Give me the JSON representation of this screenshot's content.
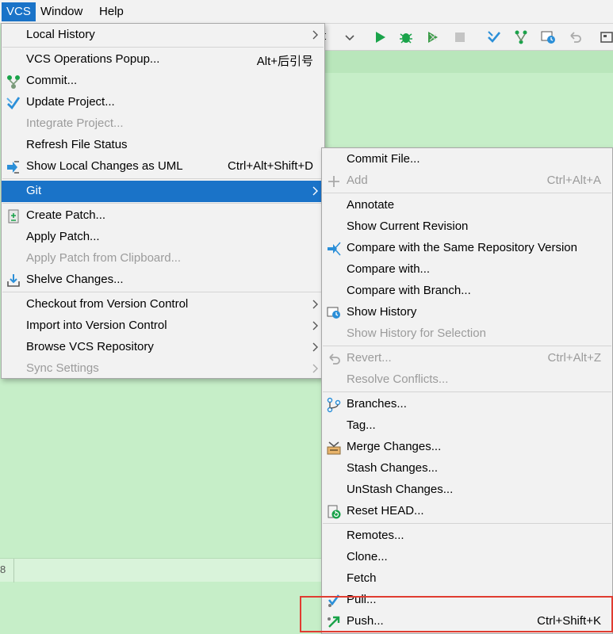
{
  "menubar": {
    "items": [
      {
        "label": "VCS",
        "active": true
      },
      {
        "label": "Window",
        "active": false
      },
      {
        "label": "Help",
        "active": false
      }
    ]
  },
  "editor": {
    "toolbar_fragment": "t",
    "line_number": "8"
  },
  "vcs_menu": {
    "items": [
      {
        "label": "Local History",
        "submenu": true
      },
      {
        "label": "VCS Operations Popup...",
        "shortcut": "Alt+后引号"
      },
      {
        "label": "Commit...",
        "icon": "commit-icon"
      },
      {
        "label": "Update Project...",
        "icon": "update-project-icon"
      },
      {
        "label": "Integrate Project...",
        "disabled": true
      },
      {
        "label": "Refresh File Status"
      },
      {
        "label": "Show Local Changes as UML",
        "shortcut": "Ctrl+Alt+Shift+D",
        "icon": "uml-icon"
      },
      {
        "label": "Git",
        "submenu": true,
        "selected": true
      },
      {
        "label": "Create Patch...",
        "icon": "patch-icon"
      },
      {
        "label": "Apply Patch..."
      },
      {
        "label": "Apply Patch from Clipboard...",
        "disabled": true
      },
      {
        "label": "Shelve Changes...",
        "icon": "shelve-icon"
      },
      {
        "label": "Checkout from Version Control",
        "submenu": true
      },
      {
        "label": "Import into Version Control",
        "submenu": true
      },
      {
        "label": "Browse VCS Repository",
        "submenu": true
      },
      {
        "label": "Sync Settings",
        "submenu": true,
        "disabled": true
      }
    ]
  },
  "git_menu": {
    "items": [
      {
        "label": "Commit File..."
      },
      {
        "label": "Add",
        "shortcut": "Ctrl+Alt+A",
        "disabled": true,
        "icon": "plus-icon"
      },
      {
        "label": "Annotate"
      },
      {
        "label": "Show Current Revision"
      },
      {
        "label": "Compare with the Same Repository Version",
        "icon": "compare-icon"
      },
      {
        "label": "Compare with..."
      },
      {
        "label": "Compare with Branch..."
      },
      {
        "label": "Show History",
        "icon": "history-icon"
      },
      {
        "label": "Show History for Selection",
        "disabled": true
      },
      {
        "label": "Revert...",
        "shortcut": "Ctrl+Alt+Z",
        "disabled": true,
        "icon": "revert-icon"
      },
      {
        "label": "Resolve Conflicts...",
        "disabled": true
      },
      {
        "label": "Branches...",
        "icon": "branches-icon"
      },
      {
        "label": "Tag..."
      },
      {
        "label": "Merge Changes...",
        "icon": "merge-icon"
      },
      {
        "label": "Stash Changes..."
      },
      {
        "label": "UnStash Changes..."
      },
      {
        "label": "Reset HEAD...",
        "icon": "reset-head-icon"
      },
      {
        "label": "Remotes..."
      },
      {
        "label": "Clone..."
      },
      {
        "label": "Fetch"
      },
      {
        "label": "Pull...",
        "icon": "pull-icon"
      },
      {
        "label": "Push...",
        "shortcut": "Ctrl+Shift+K",
        "icon": "push-icon"
      }
    ]
  },
  "colors": {
    "selection": "#1a73c8",
    "editor_background": "#c6eec8",
    "highlight_box": "#e03c31"
  }
}
